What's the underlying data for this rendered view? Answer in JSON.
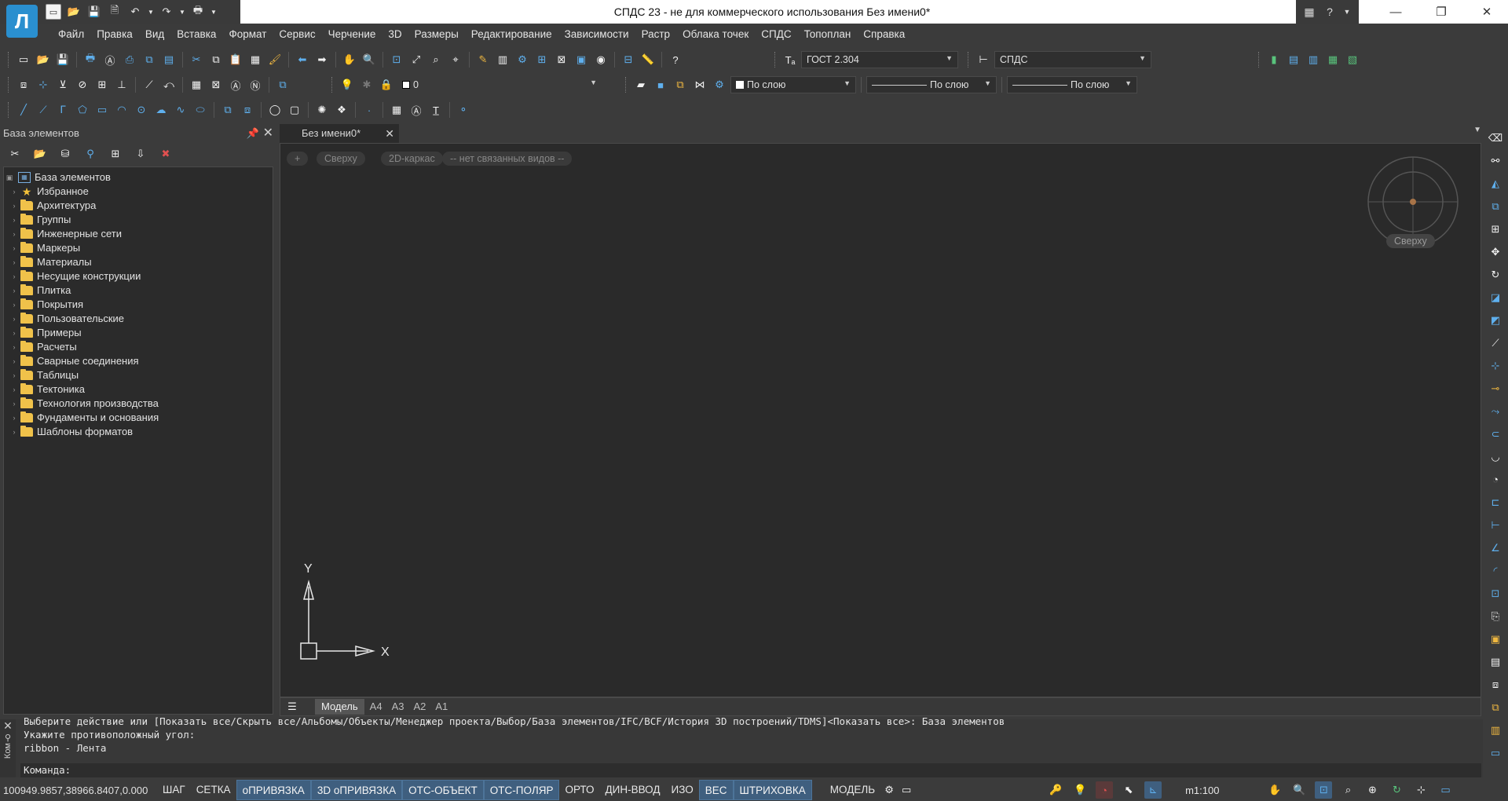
{
  "window": {
    "title": "СПДС 23 - не для коммерческого использования Без имени0*",
    "logo_glyph": "Л",
    "help_glyph": "?"
  },
  "menu": [
    "Файл",
    "Правка",
    "Вид",
    "Вставка",
    "Формат",
    "Сервис",
    "Черчение",
    "3D",
    "Размеры",
    "Редактирование",
    "Зависимости",
    "Растр",
    "Облака точек",
    "СПДС",
    "Топоплан",
    "Справка"
  ],
  "toolbar": {
    "text_style": "ГОСТ 2.304",
    "dim_style": "СПДС",
    "layer": "0",
    "color": "По слою",
    "linetype": "По слою",
    "lineweight": "По слою"
  },
  "left_panel": {
    "title": "База элементов",
    "root": "База элементов",
    "items": [
      {
        "label": "Избранное",
        "icon": "star-icon"
      },
      {
        "label": "Архитектура",
        "icon": "folder-icon"
      },
      {
        "label": "Группы",
        "icon": "folder-icon"
      },
      {
        "label": "Инженерные сети",
        "icon": "folder-icon"
      },
      {
        "label": "Маркеры",
        "icon": "folder-icon"
      },
      {
        "label": "Материалы",
        "icon": "folder-icon"
      },
      {
        "label": "Несущие конструкции",
        "icon": "folder-icon"
      },
      {
        "label": "Плитка",
        "icon": "folder-icon"
      },
      {
        "label": "Покрытия",
        "icon": "folder-icon"
      },
      {
        "label": "Пользовательские",
        "icon": "folder-icon"
      },
      {
        "label": "Примеры",
        "icon": "folder-icon"
      },
      {
        "label": "Расчеты",
        "icon": "folder-icon"
      },
      {
        "label": "Сварные соединения",
        "icon": "folder-icon"
      },
      {
        "label": "Таблицы",
        "icon": "folder-icon"
      },
      {
        "label": "Тектоника",
        "icon": "folder-icon"
      },
      {
        "label": "Технология производства",
        "icon": "folder-icon"
      },
      {
        "label": "Фундаменты и основания",
        "icon": "folder-icon"
      },
      {
        "label": "Шаблоны форматов",
        "icon": "folder-icon"
      }
    ]
  },
  "document": {
    "tab": "Без имени0*",
    "view_controls": {
      "plus": "+",
      "view": "Сверху",
      "style": "2D-каркас",
      "linked": "-- нет связанных видов --"
    },
    "viewcube_label": "Сверху",
    "axis_x": "X",
    "axis_y": "Y",
    "sheets": [
      "Модель",
      "A4",
      "A3",
      "A2",
      "A1"
    ]
  },
  "command": {
    "side_label": "Ком",
    "history": [
      "Выберите действие или [Показать все/Скрыть все/Альбомы/Объекты/Менеджер проекта/Выбор/База элементов/IFC/BCF/История 3D построений/TDMS]<Показать все>: База элементов",
      "Укажите противоположный угол:",
      "ribbon - Лента"
    ],
    "prompt": "Команда:"
  },
  "status": {
    "coords": "100949.9857,38966.8407,0.000",
    "buttons": [
      {
        "label": "ШАГ",
        "on": false
      },
      {
        "label": "СЕТКА",
        "on": false
      },
      {
        "label": "оПРИВЯЗКА",
        "on": true
      },
      {
        "label": "3D оПРИВЯЗКА",
        "on": true
      },
      {
        "label": "ОТС-ОБЪЕКТ",
        "on": true
      },
      {
        "label": "ОТС-ПОЛЯР",
        "on": true
      },
      {
        "label": "ОРТО",
        "on": false
      },
      {
        "label": "ДИН-ВВОД",
        "on": false
      },
      {
        "label": "ИЗО",
        "on": false
      },
      {
        "label": "ВЕС",
        "on": true
      },
      {
        "label": "ШТРИХОВКА",
        "on": true
      }
    ],
    "mode": "МОДЕЛЬ",
    "scale": "m1:100"
  }
}
